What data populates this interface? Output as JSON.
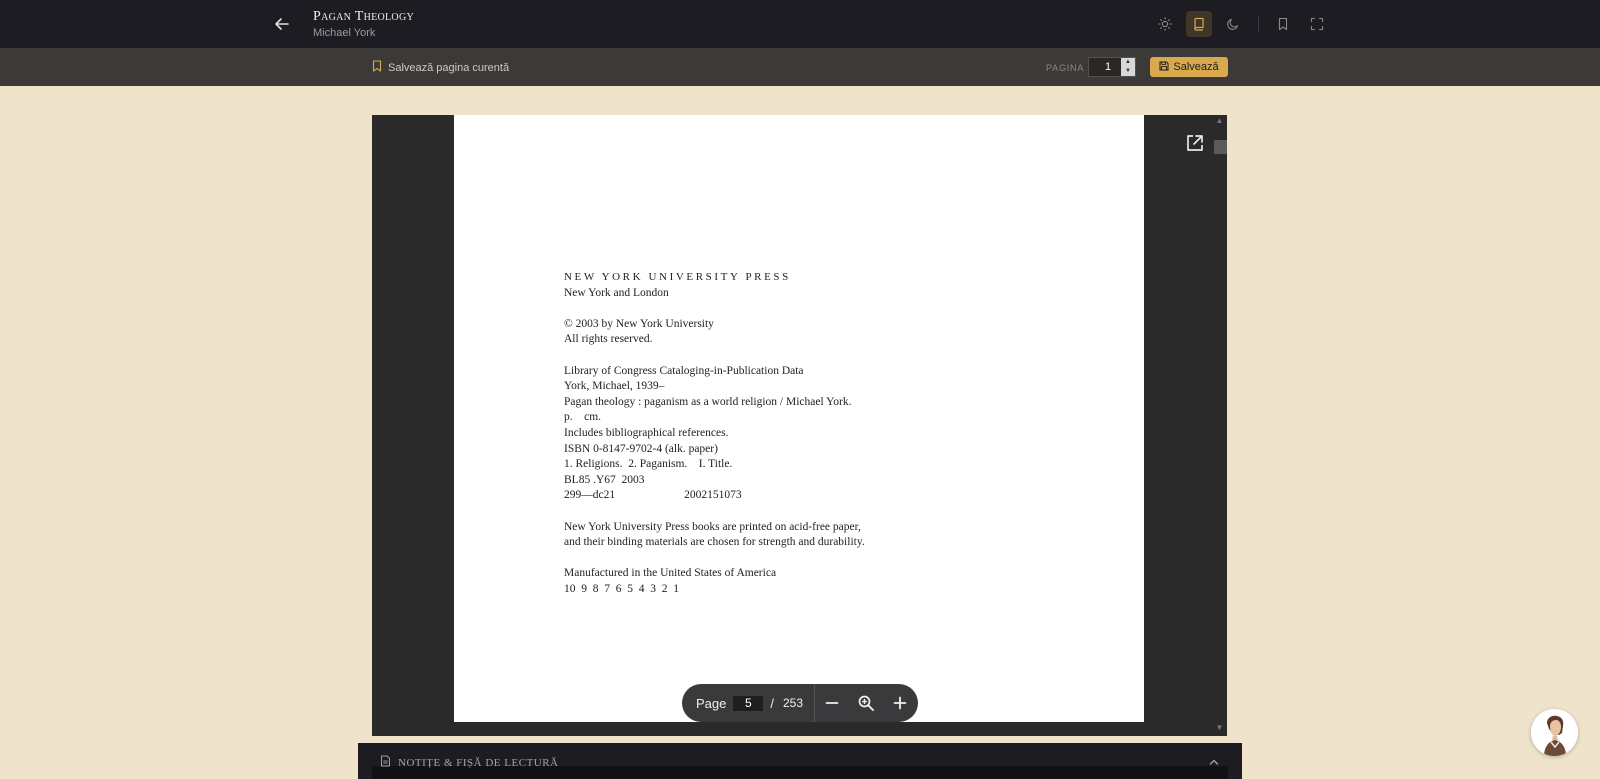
{
  "header": {
    "book_title": "Pagan Theology",
    "book_author": "Michael York",
    "icons": [
      "back-arrow-icon",
      "sun-icon",
      "book-icon",
      "moon-icon",
      "bookmark-icon",
      "fullscreen-icon"
    ]
  },
  "subbar": {
    "save_current_label": "Salvează pagina curentă",
    "pagina_label": "PAGINA",
    "pagina_value": "1",
    "save_button_label": "Salvează",
    "accent_color": "#d9a94e"
  },
  "document": {
    "press_line": "NEW YORK UNIVERSITY PRESS",
    "lines": [
      "New York and London",
      "",
      "© 2003 by New York University",
      "All rights reserved.",
      "",
      "Library of Congress Cataloging-in-Publication Data",
      "York, Michael, 1939–",
      "Pagan theology : paganism as a world religion / Michael York.",
      "p.    cm.",
      "Includes bibliographical references.",
      "ISBN 0-8147-9702-4 (alk. paper)",
      "1. Religions.  2. Paganism.    I. Title.",
      "BL85 .Y67  2003",
      "299—dc21                        2002151073",
      "",
      "New York University Press books are printed on acid-free paper,",
      "and their binding materials are chosen for strength and durability.",
      "",
      "Manufactured in the United States of America",
      "10  9  8  7  6  5  4  3  2  1"
    ]
  },
  "pdf_toolbar": {
    "page_label": "Page",
    "current_page": "5",
    "separator": "/",
    "total_pages": "253"
  },
  "notes": {
    "title": "NOTIȚE & FIȘĂ DE LECTURĂ"
  }
}
